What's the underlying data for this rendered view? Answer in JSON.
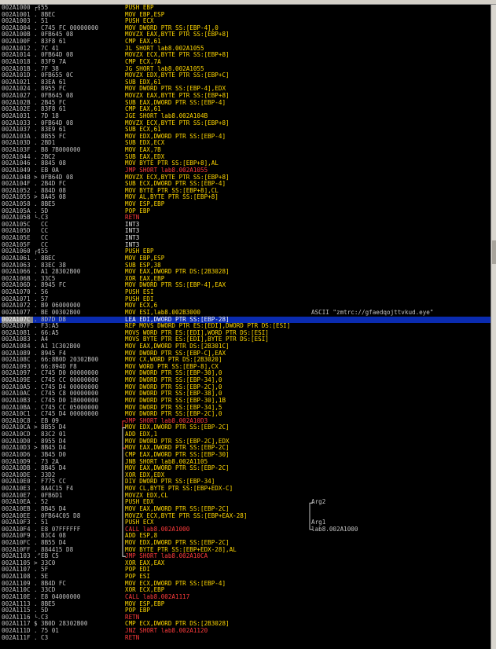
{
  "disasm": [
    {
      "addr": "002A1000",
      "mk": "┌$",
      "hex": "55",
      "dis": "PUSH EBP",
      "t": "d",
      "cmt": ""
    },
    {
      "addr": "002A1001",
      "mk": ".",
      "hex": "8BEC",
      "dis": "MOV EBP,ESP",
      "t": "d",
      "cmt": ""
    },
    {
      "addr": "002A1003",
      "mk": ".",
      "hex": "51",
      "dis": "PUSH ECX",
      "t": "d",
      "cmt": ""
    },
    {
      "addr": "002A1004",
      "mk": ".",
      "hex": "C745 FC 00000000",
      "dis": "MOV DWORD PTR SS:[EBP-4],0",
      "t": "d",
      "cmt": ""
    },
    {
      "addr": "002A100B",
      "mk": ".",
      "hex": "0FB645 08",
      "dis": "MOVZX EAX,BYTE PTR SS:[EBP+8]",
      "t": "d",
      "cmt": ""
    },
    {
      "addr": "002A100F",
      "mk": ".",
      "hex": "83F8 61",
      "dis": "CMP EAX,61",
      "t": "d",
      "cmt": ""
    },
    {
      "addr": "002A1012",
      "mk": ".",
      "hex": "7C 41",
      "dis": "JL SHORT lab8.002A1055",
      "t": "d",
      "cmt": ""
    },
    {
      "addr": "002A1014",
      "mk": ".",
      "hex": "0FB64D 08",
      "dis": "MOVZX ECX,BYTE PTR SS:[EBP+8]",
      "t": "d",
      "cmt": ""
    },
    {
      "addr": "002A1018",
      "mk": ".",
      "hex": "83F9 7A",
      "dis": "CMP ECX,7A",
      "t": "d",
      "cmt": ""
    },
    {
      "addr": "002A101B",
      "mk": ".",
      "hex": "7F 38",
      "dis": "JG SHORT lab8.002A1055",
      "t": "d",
      "cmt": ""
    },
    {
      "addr": "002A101D",
      "mk": ".",
      "hex": "0FB655 0C",
      "dis": "MOVZX EDX,BYTE PTR SS:[EBP+C]",
      "t": "d",
      "cmt": ""
    },
    {
      "addr": "002A1021",
      "mk": ".",
      "hex": "83EA 61",
      "dis": "SUB EDX,61",
      "t": "d",
      "cmt": ""
    },
    {
      "addr": "002A1024",
      "mk": ".",
      "hex": "8955 FC",
      "dis": "MOV DWORD PTR SS:[EBP-4],EDX",
      "t": "d",
      "cmt": ""
    },
    {
      "addr": "002A1027",
      "mk": ".",
      "hex": "0FB645 08",
      "dis": "MOVZX EAX,BYTE PTR SS:[EBP+8]",
      "t": "d",
      "cmt": ""
    },
    {
      "addr": "002A102B",
      "mk": ".",
      "hex": "2B45 FC",
      "dis": "SUB EAX,DWORD PTR SS:[EBP-4]",
      "t": "d",
      "cmt": ""
    },
    {
      "addr": "002A102E",
      "mk": ".",
      "hex": "83F8 61",
      "dis": "CMP EAX,61",
      "t": "d",
      "cmt": ""
    },
    {
      "addr": "002A1031",
      "mk": ".",
      "hex": "7D 18",
      "dis": "JGE SHORT lab8.002A104B",
      "t": "d",
      "cmt": ""
    },
    {
      "addr": "002A1033",
      "mk": ".",
      "hex": "0FB64D 08",
      "dis": "MOVZX ECX,BYTE PTR SS:[EBP+8]",
      "t": "d",
      "cmt": ""
    },
    {
      "addr": "002A1037",
      "mk": ".",
      "hex": "83E9 61",
      "dis": "SUB ECX,61",
      "t": "d",
      "cmt": ""
    },
    {
      "addr": "002A103A",
      "mk": ".",
      "hex": "8B55 FC",
      "dis": "MOV EDX,DWORD PTR SS:[EBP-4]",
      "t": "d",
      "cmt": ""
    },
    {
      "addr": "002A103D",
      "mk": ".",
      "hex": "2BD1",
      "dis": "SUB EDX,ECX",
      "t": "d",
      "cmt": ""
    },
    {
      "addr": "002A103F",
      "mk": ".",
      "hex": "B8 7B000000",
      "dis": "MOV EAX,7B",
      "t": "d",
      "cmt": ""
    },
    {
      "addr": "002A1044",
      "mk": ".",
      "hex": "2BC2",
      "dis": "SUB EAX,EDX",
      "t": "d",
      "cmt": ""
    },
    {
      "addr": "002A1046",
      "mk": ".",
      "hex": "8845 08",
      "dis": "MOV BYTE PTR SS:[EBP+8],AL",
      "t": "d",
      "cmt": ""
    },
    {
      "addr": "002A1049",
      "mk": ".",
      "hex": "EB 0A",
      "dis": "JMP SHORT lab8.002A1055",
      "t": "r",
      "cmt": ""
    },
    {
      "addr": "002A104B",
      "mk": ">",
      "hex": "0FB64D 08",
      "dis": "MOVZX ECX,BYTE PTR SS:[EBP+8]",
      "t": "d",
      "cmt": ""
    },
    {
      "addr": "002A104F",
      "mk": ".",
      "hex": "2B4D FC",
      "dis": "SUB ECX,DWORD PTR SS:[EBP-4]",
      "t": "d",
      "cmt": ""
    },
    {
      "addr": "002A1052",
      "mk": ".",
      "hex": "884D 08",
      "dis": "MOV BYTE PTR SS:[EBP+8],CL",
      "t": "d",
      "cmt": ""
    },
    {
      "addr": "002A1055",
      "mk": ">",
      "hex": "8A45 08",
      "dis": "MOV AL,BYTE PTR SS:[EBP+8]",
      "t": "d",
      "cmt": ""
    },
    {
      "addr": "002A1058",
      "mk": ".",
      "hex": "8BE5",
      "dis": "MOV ESP,EBP",
      "t": "d",
      "cmt": ""
    },
    {
      "addr": "002A105A",
      "mk": ".",
      "hex": "5D",
      "dis": "POP EBP",
      "t": "d",
      "cmt": ""
    },
    {
      "addr": "002A105B",
      "mk": "└.",
      "hex": "C3",
      "dis": "RETN",
      "t": "r",
      "cmt": ""
    },
    {
      "addr": "002A105C",
      "mk": "",
      "hex": "CC",
      "dis": "INT3",
      "t": "w",
      "cmt": ""
    },
    {
      "addr": "002A105D",
      "mk": "",
      "hex": "CC",
      "dis": "INT3",
      "t": "w",
      "cmt": ""
    },
    {
      "addr": "002A105E",
      "mk": "",
      "hex": "CC",
      "dis": "INT3",
      "t": "w",
      "cmt": ""
    },
    {
      "addr": "002A105F",
      "mk": "",
      "hex": "CC",
      "dis": "INT3",
      "t": "w",
      "cmt": ""
    },
    {
      "addr": "002A1060",
      "mk": "┌$",
      "hex": "55",
      "dis": "PUSH EBP",
      "t": "d",
      "cmt": ""
    },
    {
      "addr": "002A1061",
      "mk": ".",
      "hex": "8BEC",
      "dis": "MOV EBP,ESP",
      "t": "d",
      "cmt": ""
    },
    {
      "addr": "002A1063",
      "mk": ".",
      "hex": "83EC 38",
      "dis": "SUB ESP,38",
      "t": "d",
      "cmt": ""
    },
    {
      "addr": "002A1066",
      "mk": ".",
      "hex": "A1 28302B00",
      "dis": "MOV EAX,DWORD PTR DS:[2B3028]",
      "t": "d",
      "cmt": ""
    },
    {
      "addr": "002A106B",
      "mk": ".",
      "hex": "33C5",
      "dis": "XOR EAX,EBP",
      "t": "d",
      "cmt": ""
    },
    {
      "addr": "002A106D",
      "mk": ".",
      "hex": "8945 FC",
      "dis": "MOV DWORD PTR SS:[EBP-4],EAX",
      "t": "d",
      "cmt": ""
    },
    {
      "addr": "002A1070",
      "mk": ".",
      "hex": "56",
      "dis": "PUSH ESI",
      "t": "d",
      "cmt": ""
    },
    {
      "addr": "002A1071",
      "mk": ".",
      "hex": "57",
      "dis": "PUSH EDI",
      "t": "d",
      "cmt": ""
    },
    {
      "addr": "002A1072",
      "mk": ".",
      "hex": "B9 06000000",
      "dis": "MOV ECX,6",
      "t": "d",
      "cmt": ""
    },
    {
      "addr": "002A1077",
      "mk": ".",
      "hex": "BE 00302B00",
      "dis": "MOV ESI,lab8.002B3000",
      "t": "d",
      "cmt": "ASCII \"zmtrc://gfaedqojttvkud.eye\""
    },
    {
      "addr": "002A107C",
      "mk": ".",
      "hex": "8D7D D8",
      "dis": "LEA EDI,DWORD PTR SS:[EBP-28]",
      "t": "d",
      "cmt": "",
      "sel": true
    },
    {
      "addr": "002A107F",
      "mk": ".",
      "hex": "F3:A5",
      "dis": "REP MOVS DWORD PTR ES:[EDI],DWORD PTR DS:[ESI]",
      "t": "d",
      "cmt": ""
    },
    {
      "addr": "002A1081",
      "mk": ".",
      "hex": "66:A5",
      "dis": "MOVS WORD PTR ES:[EDI],WORD PTR DS:[ESI]",
      "t": "d",
      "cmt": ""
    },
    {
      "addr": "002A1083",
      "mk": ".",
      "hex": "A4",
      "dis": "MOVS BYTE PTR ES:[EDI],BYTE PTR DS:[ESI]",
      "t": "d",
      "cmt": ""
    },
    {
      "addr": "002A1084",
      "mk": ".",
      "hex": "A1 1C302B00",
      "dis": "MOV EAX,DWORD PTR DS:[2B301C]",
      "t": "d",
      "cmt": ""
    },
    {
      "addr": "002A1089",
      "mk": ".",
      "hex": "8945 F4",
      "dis": "MOV DWORD PTR SS:[EBP-C],EAX",
      "t": "d",
      "cmt": ""
    },
    {
      "addr": "002A108C",
      "mk": ".",
      "hex": "66:8B0D 20302B00",
      "dis": "MOV CX,WORD PTR DS:[2B3020]",
      "t": "d",
      "cmt": ""
    },
    {
      "addr": "002A1093",
      "mk": ".",
      "hex": "66:894D F8",
      "dis": "MOV WORD PTR SS:[EBP-8],CX",
      "t": "d",
      "cmt": ""
    },
    {
      "addr": "002A1097",
      "mk": ".",
      "hex": "C745 D0 00000000",
      "dis": "MOV DWORD PTR SS:[EBP-30],0",
      "t": "d",
      "cmt": ""
    },
    {
      "addr": "002A109E",
      "mk": ".",
      "hex": "C745 CC 00000000",
      "dis": "MOV DWORD PTR SS:[EBP-34],0",
      "t": "d",
      "cmt": ""
    },
    {
      "addr": "002A10A5",
      "mk": ".",
      "hex": "C745 D4 00000000",
      "dis": "MOV DWORD PTR SS:[EBP-2C],0",
      "t": "d",
      "cmt": ""
    },
    {
      "addr": "002A10AC",
      "mk": ".",
      "hex": "C745 C8 00000000",
      "dis": "MOV DWORD PTR SS:[EBP-38],0",
      "t": "d",
      "cmt": ""
    },
    {
      "addr": "002A10B3",
      "mk": ".",
      "hex": "C745 D0 1B000000",
      "dis": "MOV DWORD PTR SS:[EBP-30],1B",
      "t": "d",
      "cmt": ""
    },
    {
      "addr": "002A10BA",
      "mk": ".",
      "hex": "C745 CC 05000000",
      "dis": "MOV DWORD PTR SS:[EBP-34],5",
      "t": "d",
      "cmt": ""
    },
    {
      "addr": "002A10C1",
      "mk": ".",
      "hex": "C745 D4 00000000",
      "dis": "MOV DWORD PTR SS:[EBP-2C],0",
      "t": "d",
      "cmt": ""
    },
    {
      "addr": "002A10C8",
      "mk": ".",
      "hex": "EB 09",
      "dis": "JMP SHORT lab8.002A10D3",
      "t": "r",
      "cmt": ""
    },
    {
      "addr": "002A10CA",
      "mk": ">",
      "hex": "8B55 D4",
      "dis": "MOV EDX,DWORD PTR SS:[EBP-2C]",
      "t": "d",
      "cmt": ""
    },
    {
      "addr": "002A10CD",
      "mk": ".",
      "hex": "83C2 01",
      "dis": "ADD EDX,1",
      "t": "d",
      "cmt": ""
    },
    {
      "addr": "002A10D0",
      "mk": ".",
      "hex": "8955 D4",
      "dis": "MOV DWORD PTR SS:[EBP-2C],EDX",
      "t": "d",
      "cmt": ""
    },
    {
      "addr": "002A10D3",
      "mk": ">",
      "hex": "8B45 D4",
      "dis": "MOV EAX,DWORD PTR SS:[EBP-2C]",
      "t": "d",
      "cmt": ""
    },
    {
      "addr": "002A10D6",
      "mk": ".",
      "hex": "3B45 D0",
      "dis": "CMP EAX,DWORD PTR SS:[EBP-30]",
      "t": "d",
      "cmt": ""
    },
    {
      "addr": "002A10D9",
      "mk": ".",
      "hex": "73 2A",
      "dis": "JNB SHORT lab8.002A1105",
      "t": "d",
      "cmt": ""
    },
    {
      "addr": "002A10DB",
      "mk": ".",
      "hex": "8B45 D4",
      "dis": "MOV EAX,DWORD PTR SS:[EBP-2C]",
      "t": "d",
      "cmt": ""
    },
    {
      "addr": "002A10DE",
      "mk": ".",
      "hex": "33D2",
      "dis": "XOR EDX,EDX",
      "t": "d",
      "cmt": ""
    },
    {
      "addr": "002A10E0",
      "mk": ".",
      "hex": "F775 CC",
      "dis": "DIV DWORD PTR SS:[EBP-34]",
      "t": "d",
      "cmt": ""
    },
    {
      "addr": "002A10E3",
      "mk": ".",
      "hex": "8A4C15 F4",
      "dis": "MOV CL,BYTE PTR SS:[EBP+EDX-C]",
      "t": "d",
      "cmt": ""
    },
    {
      "addr": "002A10E7",
      "mk": ".",
      "hex": "0FB6D1",
      "dis": "MOVZX EDX,CL",
      "t": "d",
      "cmt": ""
    },
    {
      "addr": "002A10EA",
      "mk": ".",
      "hex": "52",
      "dis": "PUSH EDX",
      "t": "d",
      "cmt": "Arg2"
    },
    {
      "addr": "002A10EB",
      "mk": ".",
      "hex": "8B45 D4",
      "dis": "MOV EAX,DWORD PTR SS:[EBP-2C]",
      "t": "d",
      "cmt": ""
    },
    {
      "addr": "002A10EE",
      "mk": ".",
      "hex": "0FB64C05 D8",
      "dis": "MOVZX ECX,BYTE PTR SS:[EBP+EAX-28]",
      "t": "d",
      "cmt": ""
    },
    {
      "addr": "002A10F3",
      "mk": ".",
      "hex": "51",
      "dis": "PUSH ECX",
      "t": "d",
      "cmt": "Arg1"
    },
    {
      "addr": "002A10F4",
      "mk": ".",
      "hex": "E8 07FFFFFF",
      "dis": "CALL lab8.002A1000",
      "t": "r",
      "cmt": "lab8.002A1000"
    },
    {
      "addr": "002A10F9",
      "mk": ".",
      "hex": "83C4 08",
      "dis": "ADD ESP,8",
      "t": "d",
      "cmt": ""
    },
    {
      "addr": "002A10FC",
      "mk": ".",
      "hex": "8B55 D4",
      "dis": "MOV EDX,DWORD PTR SS:[EBP-2C]",
      "t": "d",
      "cmt": ""
    },
    {
      "addr": "002A10FF",
      "mk": ".",
      "hex": "884415 D8",
      "dis": "MOV BYTE PTR SS:[EBP+EDX-28],AL",
      "t": "d",
      "cmt": ""
    },
    {
      "addr": "002A1103",
      "mk": ".^",
      "hex": "EB C5",
      "dis": "JMP SHORT lab8.002A10CA",
      "t": "r",
      "cmt": ""
    },
    {
      "addr": "002A1105",
      "mk": ">",
      "hex": "33C0",
      "dis": "XOR EAX,EAX",
      "t": "d",
      "cmt": ""
    },
    {
      "addr": "002A1107",
      "mk": ".",
      "hex": "5F",
      "dis": "POP EDI",
      "t": "d",
      "cmt": ""
    },
    {
      "addr": "002A1108",
      "mk": ".",
      "hex": "5E",
      "dis": "POP ESI",
      "t": "d",
      "cmt": ""
    },
    {
      "addr": "002A1109",
      "mk": ".",
      "hex": "8B4D FC",
      "dis": "MOV ECX,DWORD PTR SS:[EBP-4]",
      "t": "d",
      "cmt": ""
    },
    {
      "addr": "002A110C",
      "mk": ".",
      "hex": "33CD",
      "dis": "XOR ECX,EBP",
      "t": "d",
      "cmt": ""
    },
    {
      "addr": "002A110E",
      "mk": ".",
      "hex": "E8 04000000",
      "dis": "CALL lab8.002A1117",
      "t": "r",
      "cmt": ""
    },
    {
      "addr": "002A1113",
      "mk": ".",
      "hex": "8BE5",
      "dis": "MOV ESP,EBP",
      "t": "d",
      "cmt": ""
    },
    {
      "addr": "002A1115",
      "mk": ".",
      "hex": "5D",
      "dis": "POP EBP",
      "t": "d",
      "cmt": ""
    },
    {
      "addr": "002A1116",
      "mk": "└.",
      "hex": "C3",
      "dis": "RETN",
      "t": "r",
      "cmt": ""
    },
    {
      "addr": "002A1117",
      "mk": "$",
      "hex": "3B0D 28302B00",
      "dis": "CMP ECX,DWORD PTR DS:[2B3028]",
      "t": "d",
      "cmt": ""
    },
    {
      "addr": "002A111D",
      "mk": ".",
      "hex": "75 01",
      "dis": "JNZ SHORT lab8.002A1120",
      "t": "r",
      "cmt": ""
    },
    {
      "addr": "002A111F",
      "mk": ".",
      "hex": "C3",
      "dis": "RETN",
      "t": "r",
      "cmt": ""
    }
  ],
  "colors": {
    "background": "#000000",
    "selection": "#0a2bb0",
    "instruction": "#ffd700",
    "control_flow": "#ff3b3b",
    "padding": "#e8e8e8",
    "comment": "#c0c0c0"
  },
  "icons": {
    "jump-arrow-icon": "▶",
    "call-bracket-icon": "┌"
  }
}
